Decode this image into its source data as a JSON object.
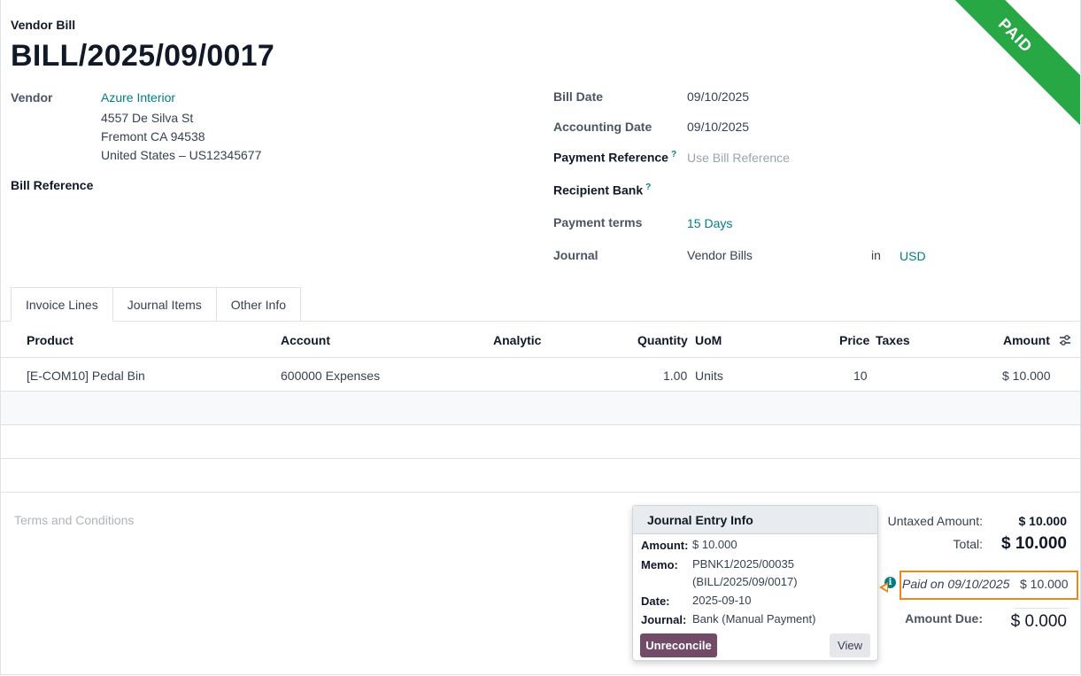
{
  "ribbon": "PAID",
  "header": {
    "doc_type": "Vendor Bill",
    "doc_name": "BILL/2025/09/0017"
  },
  "left": {
    "vendor_label": "Vendor",
    "vendor_name": "Azure Interior",
    "address_line1": "4557 De Silva St",
    "address_line2": "Fremont CA 94538",
    "address_line3": "United States – US12345677",
    "bill_ref_label": "Bill Reference"
  },
  "right": {
    "bill_date_label": "Bill Date",
    "bill_date": "09/10/2025",
    "acc_date_label": "Accounting Date",
    "acc_date": "09/10/2025",
    "pay_ref_label": "Payment Reference",
    "pay_ref_placeholder": "Use Bill Reference",
    "recipient_label": "Recipient Bank",
    "terms_label": "Payment terms",
    "terms": "15 Days",
    "journal_label": "Journal",
    "journal": "Vendor Bills",
    "in": "in",
    "currency": "USD",
    "help": "?"
  },
  "tabs": [
    "Invoice Lines",
    "Journal Items",
    "Other Info"
  ],
  "table": {
    "headers": {
      "product": "Product",
      "account": "Account",
      "analytic": "Analytic",
      "quantity": "Quantity",
      "uom": "UoM",
      "price": "Price",
      "taxes": "Taxes",
      "amount": "Amount"
    },
    "rows": [
      {
        "product": "[E-COM10] Pedal Bin",
        "account": "600000 Expenses",
        "quantity": "1.00",
        "uom": "Units",
        "price": "10",
        "amount": "$ 10.000"
      }
    ]
  },
  "terms_placeholder": "Terms and Conditions",
  "totals": {
    "untaxed_label": "Untaxed Amount:",
    "untaxed": "$ 10.000",
    "total_label": "Total:",
    "total": "$ 10.000",
    "paid_on": "Paid on 09/10/2025",
    "paid_amount": "$ 10.000",
    "due_label": "Amount Due:",
    "due": "$ 0.000"
  },
  "popover": {
    "title": "Journal Entry Info",
    "amount_label": "Amount:",
    "amount": "$ 10.000",
    "memo_label": "Memo:",
    "memo_line1": "PBNK1/2025/00035",
    "memo_line2": "(BILL/2025/09/0017)",
    "date_label": "Date:",
    "date": "2025-09-10",
    "journal_label": "Journal:",
    "journal": "Bank (Manual Payment)",
    "unreconcile": "Unreconcile",
    "view": "View"
  }
}
